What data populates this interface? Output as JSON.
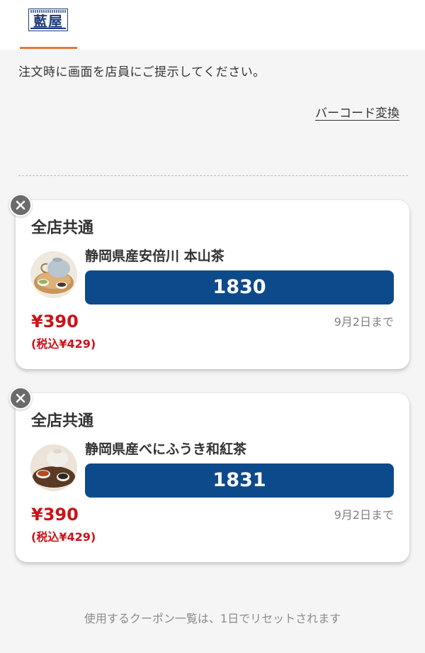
{
  "header": {
    "logo_text": "藍屋",
    "logo_small_text": "AI-YA JAPANESE RESTAURANT",
    "logo_color": "#1d3b7a",
    "active_tab_color": "#e8763a"
  },
  "notice": "注文時に画面を店員にご提示してください。",
  "barcode_link": "バーコード変換",
  "coupons": [
    {
      "store_label": "全店共通",
      "product_name": "静岡県産安倍川 本山茶",
      "code": "1830",
      "price": "¥390",
      "tax_price": "(税込¥429)",
      "expiry": "9月2日まで",
      "thumb_icon": "teapot-image"
    },
    {
      "store_label": "全店共通",
      "product_name": "静岡県産べにふうき和紅茶",
      "code": "1831",
      "price": "¥390",
      "tax_price": "(税込¥429)",
      "expiry": "9月2日まで",
      "thumb_icon": "black-tea-image"
    }
  ],
  "footer_note": "使用するクーポン一覧は、1日でリセットされます",
  "colors": {
    "code_bar": "#0d4a8c",
    "price": "#cc1219",
    "close_button": "#6b6b6b"
  }
}
